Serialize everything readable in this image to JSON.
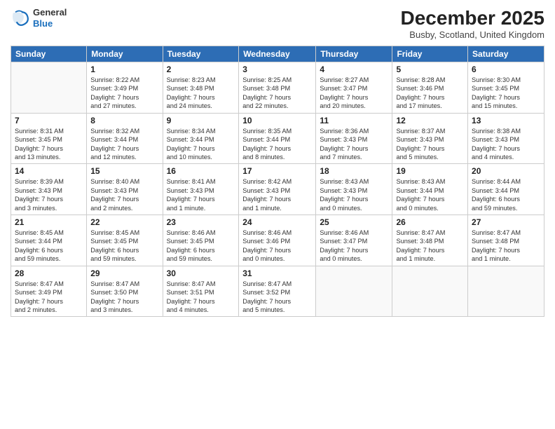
{
  "header": {
    "logo_general": "General",
    "logo_blue": "Blue",
    "month_title": "December 2025",
    "location": "Busby, Scotland, United Kingdom"
  },
  "days_of_week": [
    "Sunday",
    "Monday",
    "Tuesday",
    "Wednesday",
    "Thursday",
    "Friday",
    "Saturday"
  ],
  "weeks": [
    [
      {
        "day": "",
        "info": ""
      },
      {
        "day": "1",
        "info": "Sunrise: 8:22 AM\nSunset: 3:49 PM\nDaylight: 7 hours\nand 27 minutes."
      },
      {
        "day": "2",
        "info": "Sunrise: 8:23 AM\nSunset: 3:48 PM\nDaylight: 7 hours\nand 24 minutes."
      },
      {
        "day": "3",
        "info": "Sunrise: 8:25 AM\nSunset: 3:48 PM\nDaylight: 7 hours\nand 22 minutes."
      },
      {
        "day": "4",
        "info": "Sunrise: 8:27 AM\nSunset: 3:47 PM\nDaylight: 7 hours\nand 20 minutes."
      },
      {
        "day": "5",
        "info": "Sunrise: 8:28 AM\nSunset: 3:46 PM\nDaylight: 7 hours\nand 17 minutes."
      },
      {
        "day": "6",
        "info": "Sunrise: 8:30 AM\nSunset: 3:45 PM\nDaylight: 7 hours\nand 15 minutes."
      }
    ],
    [
      {
        "day": "7",
        "info": "Sunrise: 8:31 AM\nSunset: 3:45 PM\nDaylight: 7 hours\nand 13 minutes."
      },
      {
        "day": "8",
        "info": "Sunrise: 8:32 AM\nSunset: 3:44 PM\nDaylight: 7 hours\nand 12 minutes."
      },
      {
        "day": "9",
        "info": "Sunrise: 8:34 AM\nSunset: 3:44 PM\nDaylight: 7 hours\nand 10 minutes."
      },
      {
        "day": "10",
        "info": "Sunrise: 8:35 AM\nSunset: 3:44 PM\nDaylight: 7 hours\nand 8 minutes."
      },
      {
        "day": "11",
        "info": "Sunrise: 8:36 AM\nSunset: 3:43 PM\nDaylight: 7 hours\nand 7 minutes."
      },
      {
        "day": "12",
        "info": "Sunrise: 8:37 AM\nSunset: 3:43 PM\nDaylight: 7 hours\nand 5 minutes."
      },
      {
        "day": "13",
        "info": "Sunrise: 8:38 AM\nSunset: 3:43 PM\nDaylight: 7 hours\nand 4 minutes."
      }
    ],
    [
      {
        "day": "14",
        "info": "Sunrise: 8:39 AM\nSunset: 3:43 PM\nDaylight: 7 hours\nand 3 minutes."
      },
      {
        "day": "15",
        "info": "Sunrise: 8:40 AM\nSunset: 3:43 PM\nDaylight: 7 hours\nand 2 minutes."
      },
      {
        "day": "16",
        "info": "Sunrise: 8:41 AM\nSunset: 3:43 PM\nDaylight: 7 hours\nand 1 minute."
      },
      {
        "day": "17",
        "info": "Sunrise: 8:42 AM\nSunset: 3:43 PM\nDaylight: 7 hours\nand 1 minute."
      },
      {
        "day": "18",
        "info": "Sunrise: 8:43 AM\nSunset: 3:43 PM\nDaylight: 7 hours\nand 0 minutes."
      },
      {
        "day": "19",
        "info": "Sunrise: 8:43 AM\nSunset: 3:44 PM\nDaylight: 7 hours\nand 0 minutes."
      },
      {
        "day": "20",
        "info": "Sunrise: 8:44 AM\nSunset: 3:44 PM\nDaylight: 6 hours\nand 59 minutes."
      }
    ],
    [
      {
        "day": "21",
        "info": "Sunrise: 8:45 AM\nSunset: 3:44 PM\nDaylight: 6 hours\nand 59 minutes."
      },
      {
        "day": "22",
        "info": "Sunrise: 8:45 AM\nSunset: 3:45 PM\nDaylight: 6 hours\nand 59 minutes."
      },
      {
        "day": "23",
        "info": "Sunrise: 8:46 AM\nSunset: 3:45 PM\nDaylight: 6 hours\nand 59 minutes."
      },
      {
        "day": "24",
        "info": "Sunrise: 8:46 AM\nSunset: 3:46 PM\nDaylight: 7 hours\nand 0 minutes."
      },
      {
        "day": "25",
        "info": "Sunrise: 8:46 AM\nSunset: 3:47 PM\nDaylight: 7 hours\nand 0 minutes."
      },
      {
        "day": "26",
        "info": "Sunrise: 8:47 AM\nSunset: 3:48 PM\nDaylight: 7 hours\nand 1 minute."
      },
      {
        "day": "27",
        "info": "Sunrise: 8:47 AM\nSunset: 3:48 PM\nDaylight: 7 hours\nand 1 minute."
      }
    ],
    [
      {
        "day": "28",
        "info": "Sunrise: 8:47 AM\nSunset: 3:49 PM\nDaylight: 7 hours\nand 2 minutes."
      },
      {
        "day": "29",
        "info": "Sunrise: 8:47 AM\nSunset: 3:50 PM\nDaylight: 7 hours\nand 3 minutes."
      },
      {
        "day": "30",
        "info": "Sunrise: 8:47 AM\nSunset: 3:51 PM\nDaylight: 7 hours\nand 4 minutes."
      },
      {
        "day": "31",
        "info": "Sunrise: 8:47 AM\nSunset: 3:52 PM\nDaylight: 7 hours\nand 5 minutes."
      },
      {
        "day": "",
        "info": ""
      },
      {
        "day": "",
        "info": ""
      },
      {
        "day": "",
        "info": ""
      }
    ]
  ]
}
